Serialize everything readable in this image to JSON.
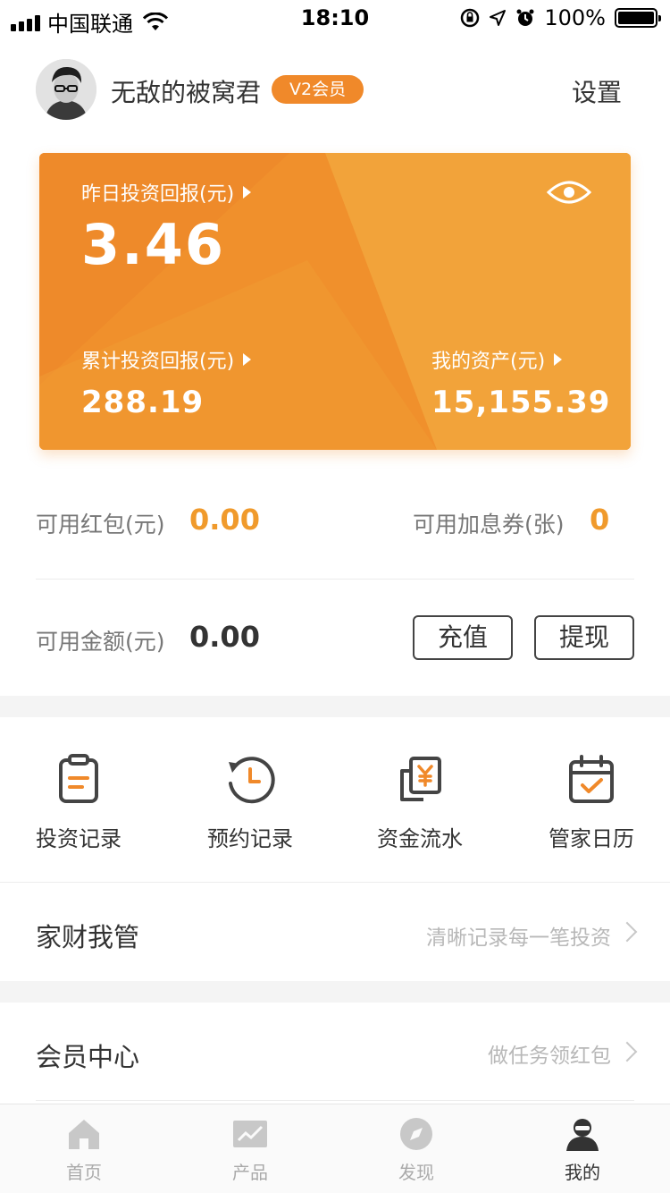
{
  "status_bar": {
    "carrier": "中国联通",
    "time": "18:10",
    "battery": "100%",
    "icons": [
      "signal-icon",
      "wifi-icon",
      "rotation-lock-icon",
      "location-icon",
      "alarm-icon",
      "battery-icon"
    ]
  },
  "profile": {
    "username": "无敌的被窝君",
    "vip_badge": "V2会员",
    "settings_label": "设置"
  },
  "card": {
    "yesterday_label": "昨日投资回报(元)",
    "yesterday_value": "3.46",
    "total_label": "累计投资回报(元)",
    "total_value": "288.19",
    "assets_label": "我的资产(元)",
    "assets_value": "15,155.39",
    "eye_icon": "eye-icon"
  },
  "balances": {
    "red_packet_label": "可用红包(元)",
    "red_packet_value": "0.00",
    "coupon_label": "可用加息券(张)",
    "coupon_value": "0",
    "available_label": "可用金额(元)",
    "available_value": "0.00",
    "recharge_label": "充值",
    "withdraw_label": "提现"
  },
  "shortcuts": [
    {
      "label": "投资记录",
      "icon": "clipboard-icon"
    },
    {
      "label": "预约记录",
      "icon": "history-clock-icon"
    },
    {
      "label": "资金流水",
      "icon": "yuan-receipt-icon"
    },
    {
      "label": "管家日历",
      "icon": "calendar-check-icon"
    }
  ],
  "list": [
    {
      "title": "家财我管",
      "hint": "清晰记录每一笔投资"
    },
    {
      "title": "会员中心",
      "hint": "做任务领红包"
    }
  ],
  "tabs": [
    {
      "label": "首页",
      "icon": "home-icon",
      "active": false
    },
    {
      "label": "产品",
      "icon": "chart-icon",
      "active": false
    },
    {
      "label": "发现",
      "icon": "compass-icon",
      "active": false
    },
    {
      "label": "我的",
      "icon": "user-icon",
      "active": true
    }
  ],
  "colors": {
    "accent": "#f0902c",
    "accent_text": "#f09a2c",
    "text_dark": "#333333",
    "text_muted": "#777777"
  }
}
